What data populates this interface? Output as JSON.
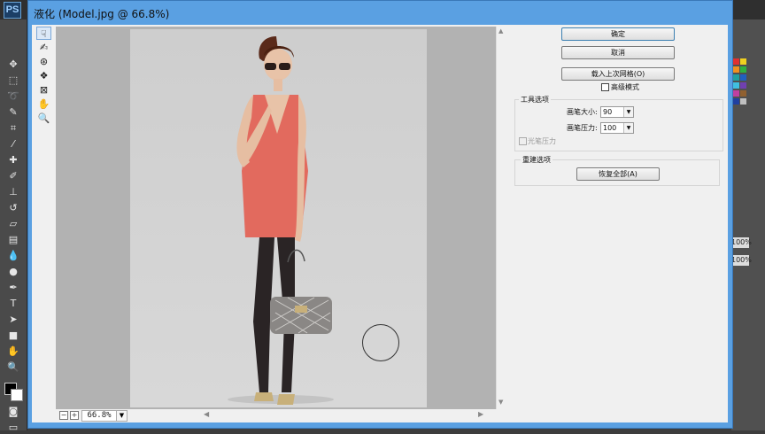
{
  "app": {
    "logo": "PS"
  },
  "window": {
    "title": "液化 (Model.jpg @ 66.8%)"
  },
  "buttons": {
    "ok": "确定",
    "cancel": "取消",
    "load_last_mesh": "载入上次网格(O)",
    "restore_all": "恢复全部(A)"
  },
  "advanced_mode": {
    "label": "高级模式",
    "checked": false
  },
  "tool_options": {
    "title": "工具选项",
    "brush_size_label": "画笔大小:",
    "brush_size_value": "90",
    "brush_pressure_label": "画笔压力:",
    "brush_pressure_value": "100",
    "stylus_pressure_label": "光笔压力",
    "stylus_pressure_checked": false
  },
  "reconstruct": {
    "title": "重建选项"
  },
  "status": {
    "zoom": "66.8%"
  },
  "right_panel": {
    "pct1": "100%",
    "pct2": "100%"
  },
  "colors": {
    "accent": "#5aa0e2",
    "dress": "#e26a5e"
  },
  "icons": [
    "forward-warp-icon",
    "reconstruct-icon",
    "pucker-icon",
    "bloat-icon",
    "push-left-icon",
    "hand-icon",
    "zoom-icon"
  ]
}
